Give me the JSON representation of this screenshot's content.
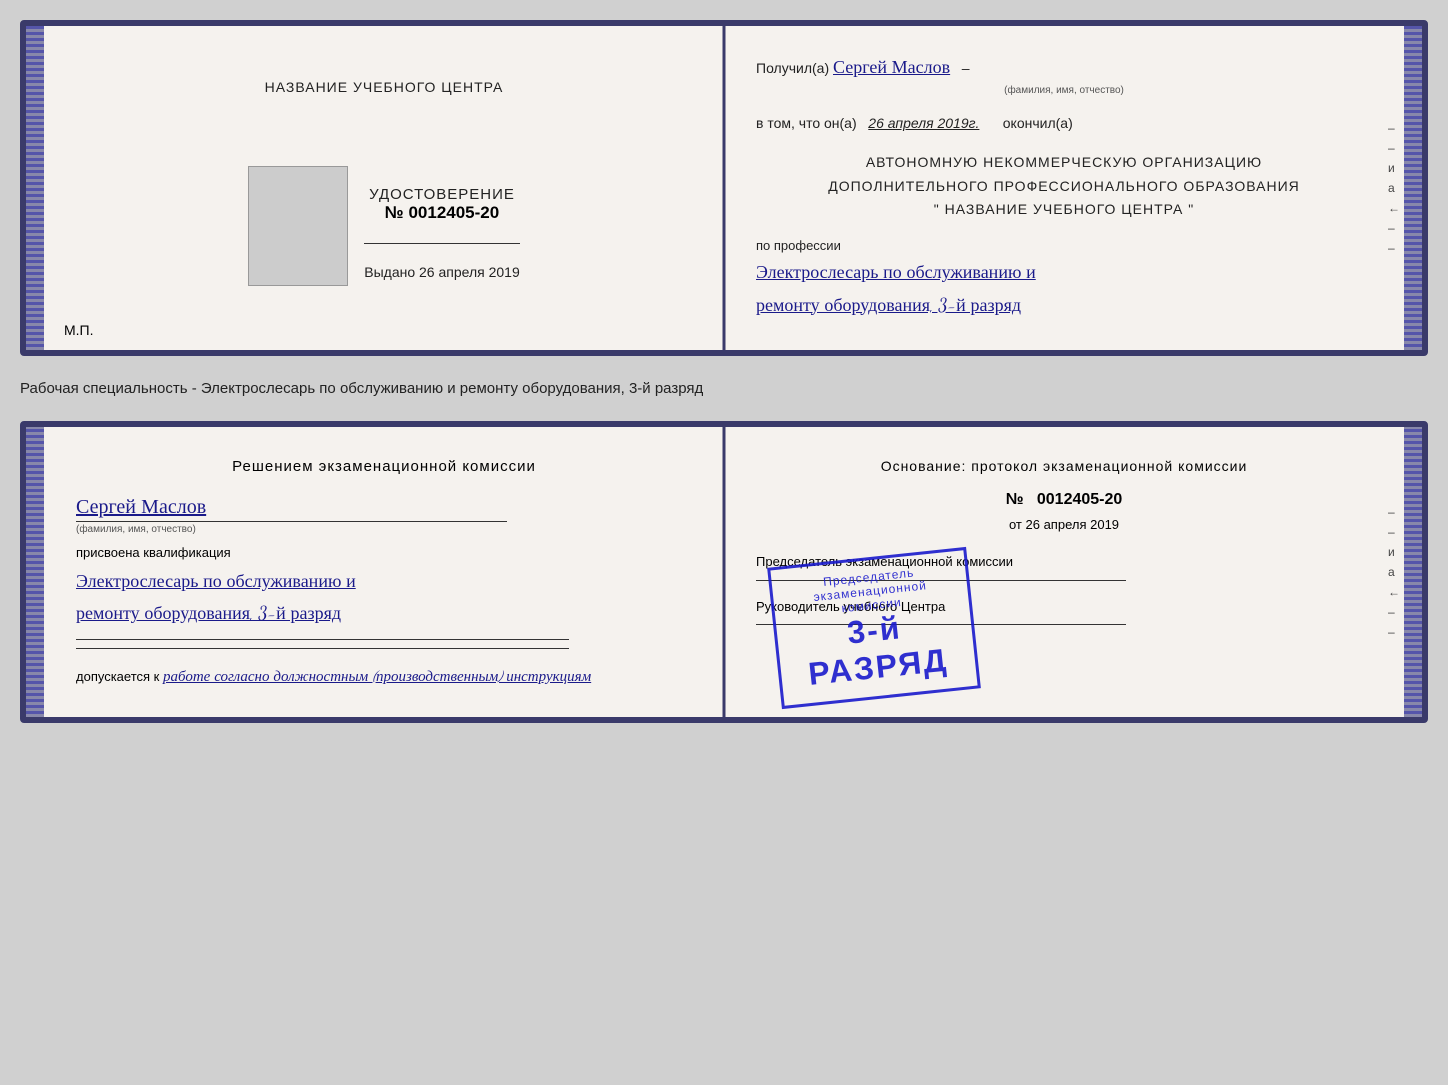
{
  "top_cert": {
    "left": {
      "header": "НАЗВАНИЕ УЧЕБНОГО ЦЕНТРА",
      "photo_alt": "фото",
      "udostoverenie": "УДОСТОВЕРЕНИЕ",
      "number_prefix": "№",
      "number": "0012405-20",
      "vydano_label": "Выдано",
      "vydano_date": "26 апреля 2019",
      "mp": "М.П."
    },
    "right": {
      "poluchil_prefix": "Получил(а)",
      "recipient_name": "Сергей Маслов",
      "fio_label": "(фамилия, имя, отчество)",
      "vtom_prefix": "в том, что он(а)",
      "vtom_date": "26 апреля 2019г.",
      "okonchil": "окончил(а)",
      "org_line1": "АВТОНОМНУЮ НЕКОММЕРЧЕСКУЮ ОРГАНИЗАЦИЮ",
      "org_line2": "ДОПОЛНИТЕЛЬНОГО ПРОФЕССИОНАЛЬНОГО ОБРАЗОВАНИЯ",
      "org_line3": "\"     НАЗВАНИЕ УЧЕБНОГО ЦЕНТРА     \"",
      "po_professii": "по профессии",
      "profession_line1": "Электрослесарь по обслуживанию и",
      "profession_line2": "ремонту оборудования, 3-й разряд"
    }
  },
  "separator": {
    "text": "Рабочая специальность - Электрослесарь по обслуживанию и ремонту оборудования, 3-й разряд"
  },
  "bottom_cert": {
    "left": {
      "resheniem": "Решением экзаменационной комиссии",
      "recipient_name": "Сергей Маслов",
      "fio_label": "(фамилия, имя, отчество)",
      "prisvoena": "присвоена квалификация",
      "profession_line1": "Электрослесарь по обслуживанию и",
      "profession_line2": "ремонту оборудования, 3-й разряд",
      "dopuskaetsya": "допускается к",
      "dopusk_text": "работе согласно должностным (производственным) инструкциям"
    },
    "right": {
      "osnovanie": "Основание: протокол экзаменационной комиссии",
      "number_prefix": "№",
      "number": "0012405-20",
      "ot_prefix": "от",
      "ot_date": "26 апреля 2019",
      "predsedatel_label": "Председатель экзаменационной комиссии",
      "rukovoditel_label": "Руководитель учебного Центра"
    },
    "stamp": {
      "line1": "3-й разряд",
      "large_text": "3-й РАЗРЯД"
    }
  },
  "right_margin": [
    "и",
    "а",
    "←",
    "–",
    "–",
    "–",
    "–"
  ]
}
